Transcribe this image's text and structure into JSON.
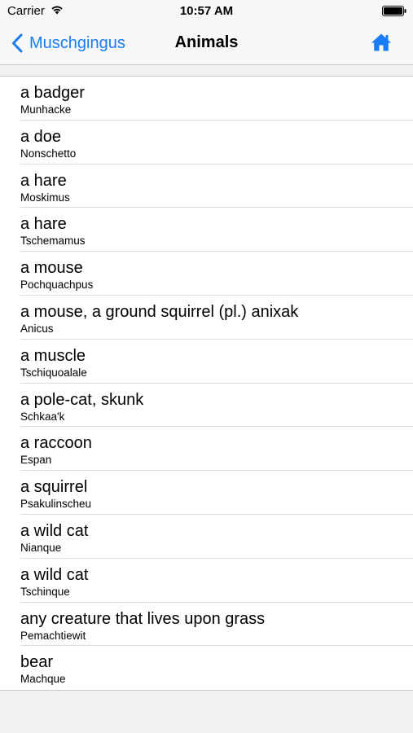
{
  "status_bar": {
    "carrier": "Carrier",
    "time": "10:57 AM",
    "wifi_icon": "wifi-icon",
    "battery_icon": "battery-icon"
  },
  "nav": {
    "back_label": "Muschgingus",
    "title": "Animals",
    "home_icon": "home-icon",
    "accent_color": "#1a7cf5"
  },
  "items": [
    {
      "title": "a badger",
      "subtitle": "Munhacke"
    },
    {
      "title": "a doe",
      "subtitle": "Nonschetto"
    },
    {
      "title": "a hare",
      "subtitle": "Moskimus"
    },
    {
      "title": "a hare",
      "subtitle": "Tschemamus"
    },
    {
      "title": "a mouse",
      "subtitle": "Pochquachpus"
    },
    {
      "title": "a mouse, a ground squirrel (pl.) anixak",
      "subtitle": "Anicus"
    },
    {
      "title": "a muscle",
      "subtitle": "Tschiquoalale"
    },
    {
      "title": "a pole-cat, skunk",
      "subtitle": "Schkaa'k"
    },
    {
      "title": "a raccoon",
      "subtitle": "Espan"
    },
    {
      "title": "a squirrel",
      "subtitle": "Psakulinscheu"
    },
    {
      "title": "a wild cat",
      "subtitle": "Nianque"
    },
    {
      "title": "a wild cat",
      "subtitle": "Tschinque"
    },
    {
      "title": "any creature that lives upon grass",
      "subtitle": "Pemachtiewit"
    },
    {
      "title": "bear",
      "subtitle": "Machque"
    }
  ]
}
